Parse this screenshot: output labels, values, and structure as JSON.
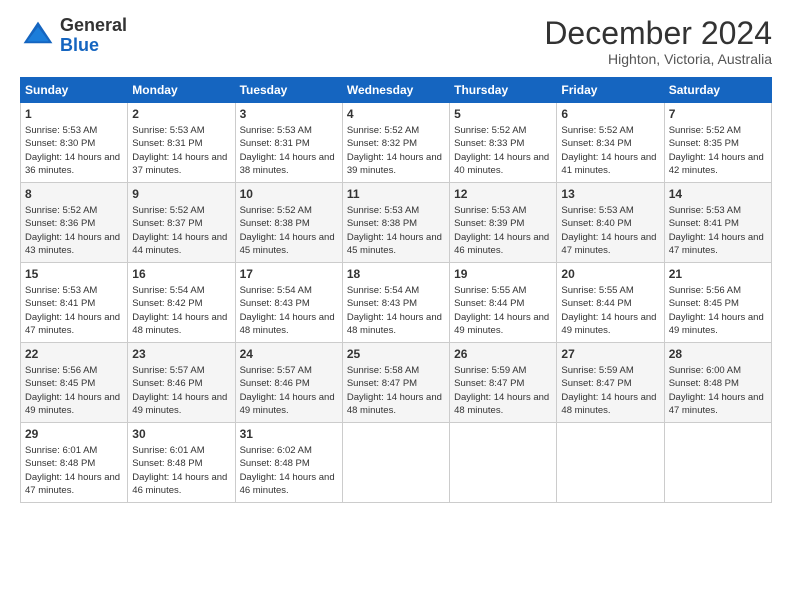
{
  "header": {
    "logo_line1": "General",
    "logo_line2": "Blue",
    "month": "December 2024",
    "location": "Highton, Victoria, Australia"
  },
  "weekdays": [
    "Sunday",
    "Monday",
    "Tuesday",
    "Wednesday",
    "Thursday",
    "Friday",
    "Saturday"
  ],
  "weeks": [
    [
      {
        "day": 1,
        "sunrise": "5:53 AM",
        "sunset": "8:30 PM",
        "daylight": "14 hours and 36 minutes."
      },
      {
        "day": 2,
        "sunrise": "5:53 AM",
        "sunset": "8:31 PM",
        "daylight": "14 hours and 37 minutes."
      },
      {
        "day": 3,
        "sunrise": "5:53 AM",
        "sunset": "8:31 PM",
        "daylight": "14 hours and 38 minutes."
      },
      {
        "day": 4,
        "sunrise": "5:52 AM",
        "sunset": "8:32 PM",
        "daylight": "14 hours and 39 minutes."
      },
      {
        "day": 5,
        "sunrise": "5:52 AM",
        "sunset": "8:33 PM",
        "daylight": "14 hours and 40 minutes."
      },
      {
        "day": 6,
        "sunrise": "5:52 AM",
        "sunset": "8:34 PM",
        "daylight": "14 hours and 41 minutes."
      },
      {
        "day": 7,
        "sunrise": "5:52 AM",
        "sunset": "8:35 PM",
        "daylight": "14 hours and 42 minutes."
      }
    ],
    [
      {
        "day": 8,
        "sunrise": "5:52 AM",
        "sunset": "8:36 PM",
        "daylight": "14 hours and 43 minutes."
      },
      {
        "day": 9,
        "sunrise": "5:52 AM",
        "sunset": "8:37 PM",
        "daylight": "14 hours and 44 minutes."
      },
      {
        "day": 10,
        "sunrise": "5:52 AM",
        "sunset": "8:38 PM",
        "daylight": "14 hours and 45 minutes."
      },
      {
        "day": 11,
        "sunrise": "5:53 AM",
        "sunset": "8:38 PM",
        "daylight": "14 hours and 45 minutes."
      },
      {
        "day": 12,
        "sunrise": "5:53 AM",
        "sunset": "8:39 PM",
        "daylight": "14 hours and 46 minutes."
      },
      {
        "day": 13,
        "sunrise": "5:53 AM",
        "sunset": "8:40 PM",
        "daylight": "14 hours and 47 minutes."
      },
      {
        "day": 14,
        "sunrise": "5:53 AM",
        "sunset": "8:41 PM",
        "daylight": "14 hours and 47 minutes."
      }
    ],
    [
      {
        "day": 15,
        "sunrise": "5:53 AM",
        "sunset": "8:41 PM",
        "daylight": "14 hours and 47 minutes."
      },
      {
        "day": 16,
        "sunrise": "5:54 AM",
        "sunset": "8:42 PM",
        "daylight": "14 hours and 48 minutes."
      },
      {
        "day": 17,
        "sunrise": "5:54 AM",
        "sunset": "8:43 PM",
        "daylight": "14 hours and 48 minutes."
      },
      {
        "day": 18,
        "sunrise": "5:54 AM",
        "sunset": "8:43 PM",
        "daylight": "14 hours and 48 minutes."
      },
      {
        "day": 19,
        "sunrise": "5:55 AM",
        "sunset": "8:44 PM",
        "daylight": "14 hours and 49 minutes."
      },
      {
        "day": 20,
        "sunrise": "5:55 AM",
        "sunset": "8:44 PM",
        "daylight": "14 hours and 49 minutes."
      },
      {
        "day": 21,
        "sunrise": "5:56 AM",
        "sunset": "8:45 PM",
        "daylight": "14 hours and 49 minutes."
      }
    ],
    [
      {
        "day": 22,
        "sunrise": "5:56 AM",
        "sunset": "8:45 PM",
        "daylight": "14 hours and 49 minutes."
      },
      {
        "day": 23,
        "sunrise": "5:57 AM",
        "sunset": "8:46 PM",
        "daylight": "14 hours and 49 minutes."
      },
      {
        "day": 24,
        "sunrise": "5:57 AM",
        "sunset": "8:46 PM",
        "daylight": "14 hours and 49 minutes."
      },
      {
        "day": 25,
        "sunrise": "5:58 AM",
        "sunset": "8:47 PM",
        "daylight": "14 hours and 48 minutes."
      },
      {
        "day": 26,
        "sunrise": "5:59 AM",
        "sunset": "8:47 PM",
        "daylight": "14 hours and 48 minutes."
      },
      {
        "day": 27,
        "sunrise": "5:59 AM",
        "sunset": "8:47 PM",
        "daylight": "14 hours and 48 minutes."
      },
      {
        "day": 28,
        "sunrise": "6:00 AM",
        "sunset": "8:48 PM",
        "daylight": "14 hours and 47 minutes."
      }
    ],
    [
      {
        "day": 29,
        "sunrise": "6:01 AM",
        "sunset": "8:48 PM",
        "daylight": "14 hours and 47 minutes."
      },
      {
        "day": 30,
        "sunrise": "6:01 AM",
        "sunset": "8:48 PM",
        "daylight": "14 hours and 46 minutes."
      },
      {
        "day": 31,
        "sunrise": "6:02 AM",
        "sunset": "8:48 PM",
        "daylight": "14 hours and 46 minutes."
      },
      null,
      null,
      null,
      null
    ]
  ]
}
